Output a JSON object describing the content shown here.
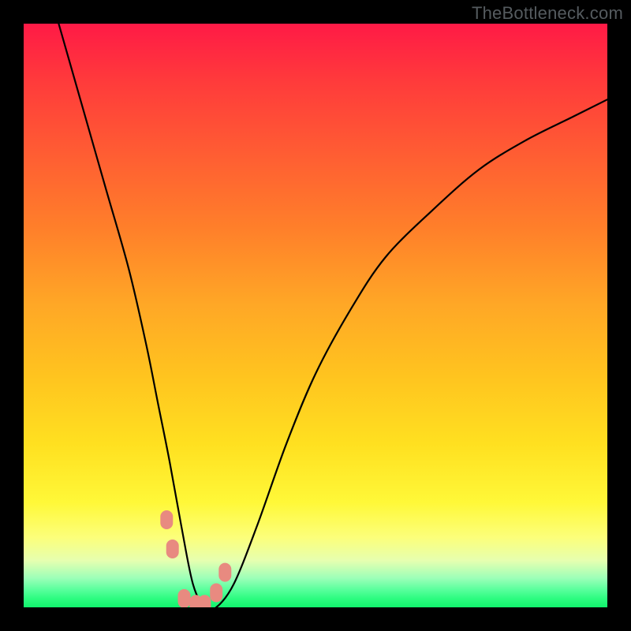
{
  "watermark": "TheBottleneck.com",
  "chart_data": {
    "type": "line",
    "title": "",
    "xlabel": "",
    "ylabel": "",
    "xlim": [
      0,
      100
    ],
    "ylim": [
      0,
      100
    ],
    "grid": false,
    "series": [
      {
        "name": "curve",
        "color": "#000000",
        "x": [
          6.0,
          10.0,
          14.0,
          18.0,
          21.0,
          23.0,
          25.0,
          27.0,
          29.0,
          31.0,
          33.0,
          36.0,
          40.0,
          45.0,
          50.0,
          56.0,
          62.0,
          70.0,
          78.0,
          86.0,
          94.0,
          100.0
        ],
        "percent": [
          100,
          86,
          72,
          58,
          45,
          35,
          25,
          14,
          4,
          0,
          0,
          4,
          14,
          28,
          40,
          51,
          60,
          68,
          75,
          80,
          84,
          87
        ]
      }
    ],
    "markers": [
      {
        "x": 24.5,
        "percent": 15.0,
        "color": "#e88a80"
      },
      {
        "x": 25.5,
        "percent": 10.0,
        "color": "#e88a80"
      },
      {
        "x": 27.5,
        "percent": 1.5,
        "color": "#e88a80"
      },
      {
        "x": 29.5,
        "percent": 0.5,
        "color": "#e88a80"
      },
      {
        "x": 31.0,
        "percent": 0.5,
        "color": "#e88a80"
      },
      {
        "x": 33.0,
        "percent": 2.5,
        "color": "#e88a80"
      },
      {
        "x": 34.5,
        "percent": 6.0,
        "color": "#e88a80"
      }
    ],
    "background_gradient": {
      "stops": [
        {
          "pos": 0.0,
          "color": "#ff1a46"
        },
        {
          "pos": 0.5,
          "color": "#ffb324"
        },
        {
          "pos": 0.85,
          "color": "#fff838"
        },
        {
          "pos": 1.0,
          "color": "#11f36d"
        }
      ]
    }
  }
}
